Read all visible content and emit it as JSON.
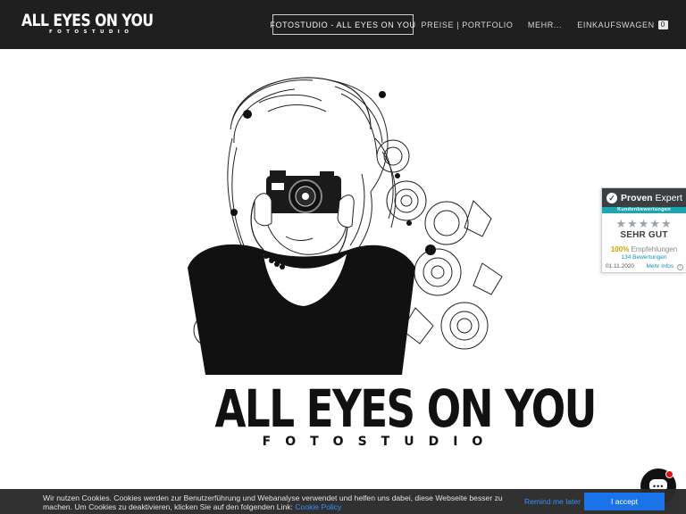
{
  "header": {
    "logo": {
      "title": "ALL EYES ON YOU",
      "subtitle": "FOTOSTUDIO"
    },
    "nav": [
      {
        "label": "FOTOSTUDIO - ALL EYES ON YOU",
        "active": true
      },
      {
        "label": "PREISE | PORTFOLIO",
        "active": false
      },
      {
        "label": "MEHR...",
        "active": false
      },
      {
        "label": "EINKAUFSWAGEN",
        "active": false
      }
    ],
    "cart_count": "0"
  },
  "hero": {
    "brand_title": "ALL EYES ON YOU",
    "brand_subtitle": "FOTOSTUDIO"
  },
  "proven_expert": {
    "brand_bold": "Proven",
    "brand_light": "Expert",
    "ribbon": "Kundenbewertungen",
    "stars": "★★★★★",
    "rating": "SEHR GUT",
    "recommend_percent": "100%",
    "recommend_label": "Empfehlungen",
    "reviews": "134 Bewertungen",
    "date": "01.11.2020",
    "more": "Mehr Infos"
  },
  "cookie": {
    "text": "Wir nutzen Cookies. Cookies werden zur Benutzerführung und Webanalyse verwendet und helfen uns dabei, diese Webseite besser zu machen. Um Cookies zu deaktivieren, klicken Sie auf den folgenden Link:",
    "link": "Cookie Policy",
    "remind": "Remind me later",
    "accept": "I accept"
  },
  "colors": {
    "header_bg": "#1f1f1f",
    "accent_link": "#2d8cff",
    "accept_button": "#1a73e8",
    "pe_teal": "#1aa7b4",
    "notify_red": "#e01010"
  },
  "icons": [
    "chat-icon",
    "info-icon",
    "proven-expert-logo-icon"
  ]
}
